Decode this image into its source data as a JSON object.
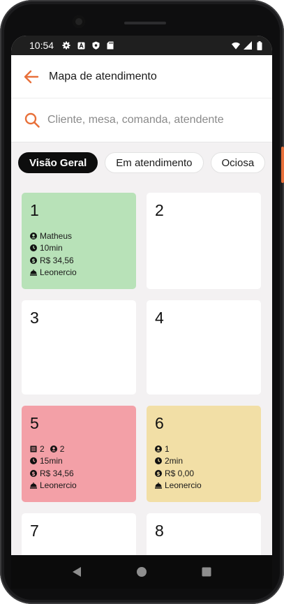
{
  "status_bar": {
    "time": "10:54",
    "icons_left": [
      "settings-icon",
      "a-icon",
      "shield-icon",
      "sd-card-icon"
    ],
    "icons_right": [
      "wifi-icon",
      "signal-icon",
      "battery-icon"
    ]
  },
  "app_bar": {
    "back_icon": "arrow-left-icon",
    "title": "Mapa de atendimento",
    "accent_color": "#e8703a"
  },
  "search": {
    "placeholder": "Cliente, mesa, comanda, atendente"
  },
  "filters": [
    {
      "label": "Visão Geral",
      "active": true
    },
    {
      "label": "Em atendimento",
      "active": false
    },
    {
      "label": "Ociosa",
      "active": false
    }
  ],
  "tables": [
    {
      "number": "1",
      "status": "green",
      "client": "Matheus",
      "time": "10min",
      "amount": "R$ 34,56",
      "waiter": "Leonercio"
    },
    {
      "number": "2",
      "status": "free"
    },
    {
      "number": "3",
      "status": "free"
    },
    {
      "number": "4",
      "status": "free"
    },
    {
      "number": "5",
      "status": "red",
      "comandas": "2",
      "people": "2",
      "time": "15min",
      "amount": "R$ 34,56",
      "waiter": "Leonercio"
    },
    {
      "number": "6",
      "status": "yellow",
      "people": "1",
      "time": "2min",
      "amount": "R$ 0,00",
      "waiter": "Leonercio"
    },
    {
      "number": "7",
      "status": "free"
    },
    {
      "number": "8",
      "status": "free"
    }
  ],
  "colors": {
    "green": "#b8e2b8",
    "red": "#f3a0a7",
    "yellow": "#f2dfa6",
    "free": "#ffffff"
  },
  "nav": [
    "back-triangle-icon",
    "home-circle-icon",
    "recents-square-icon"
  ]
}
